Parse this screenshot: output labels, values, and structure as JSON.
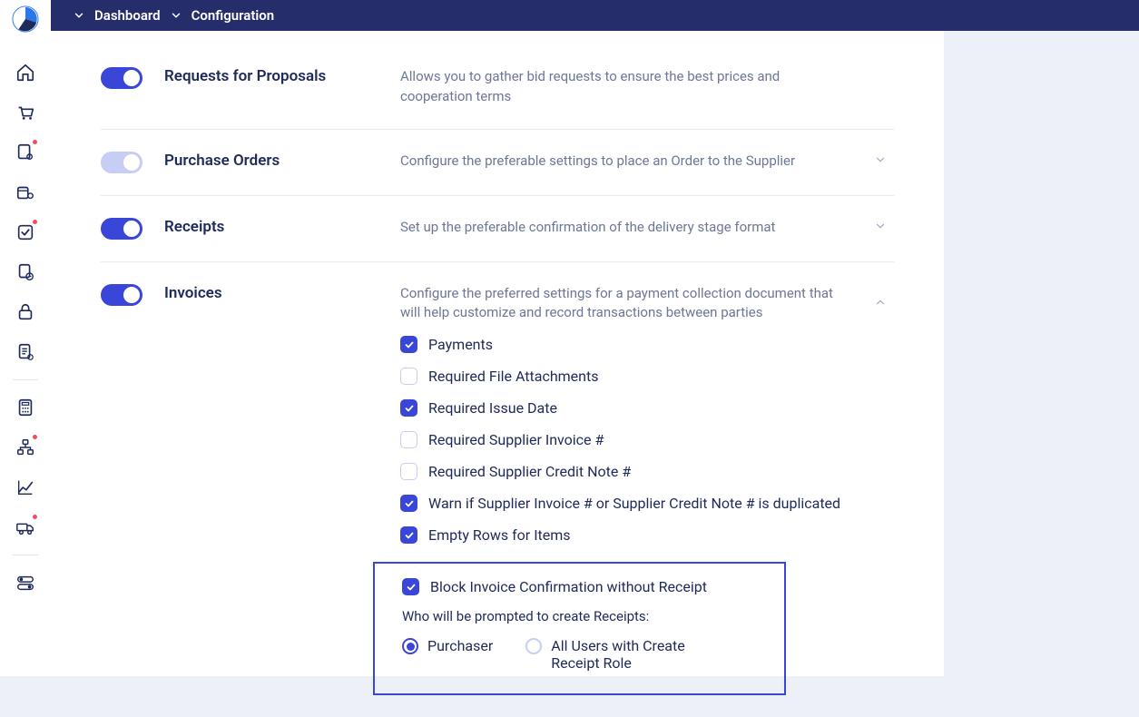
{
  "breadcrumb": {
    "items": [
      "Dashboard",
      "Configuration"
    ]
  },
  "sidebar": {
    "items": [
      {
        "name": "home-icon",
        "badge": false
      },
      {
        "name": "cart-icon",
        "badge": false
      },
      {
        "name": "doc-person-icon",
        "badge": true
      },
      {
        "name": "box-person-icon",
        "badge": false
      },
      {
        "name": "checkbox-icon",
        "badge": true
      },
      {
        "name": "doc-clock-icon",
        "badge": false
      },
      {
        "name": "lock-icon",
        "badge": false
      },
      {
        "name": "doc-list-icon",
        "badge": false
      }
    ],
    "bottomItems": [
      {
        "name": "calculator-icon",
        "badge": false
      },
      {
        "name": "org-chart-icon",
        "badge": true
      },
      {
        "name": "chart-line-icon",
        "badge": false
      },
      {
        "name": "truck-icon",
        "badge": true
      }
    ],
    "last": [
      {
        "name": "toggle-icon",
        "badge": false
      }
    ]
  },
  "sections": [
    {
      "key": "rfp",
      "toggle": true,
      "title": "Requests for Proposals",
      "desc": "Allows you to gather bid requests to ensure the best prices and cooperation terms",
      "expandable": false
    },
    {
      "key": "po",
      "toggle": false,
      "title": "Purchase Orders",
      "desc": "Configure the preferable settings to place an Order to the Supplier",
      "expandable": true,
      "expanded": false
    },
    {
      "key": "receipts",
      "toggle": true,
      "title": "Receipts",
      "desc": "Set up the preferable confirmation of the delivery stage format",
      "expandable": true,
      "expanded": false
    },
    {
      "key": "invoices",
      "toggle": true,
      "title": "Invoices",
      "desc": "Configure the preferred settings for a payment collection document that will help customize and record transactions between parties",
      "expandable": true,
      "expanded": true,
      "options": [
        {
          "label": "Payments",
          "checked": true
        },
        {
          "label": "Required File Attachments",
          "checked": false
        },
        {
          "label": "Required Issue Date",
          "checked": true
        },
        {
          "label": "Required Supplier Invoice #",
          "checked": false
        },
        {
          "label": "Required Supplier Credit Note #",
          "checked": false
        },
        {
          "label": "Warn if Supplier Invoice # or Supplier Credit Note # is duplicated",
          "checked": true
        },
        {
          "label": "Empty Rows for Items",
          "checked": true
        }
      ],
      "highlight": {
        "option": {
          "label": "Block Invoice Confirmation without Receipt",
          "checked": true
        },
        "promptLabel": "Who will be prompted to create Receipts:",
        "radios": [
          {
            "label": "Purchaser",
            "selected": true
          },
          {
            "label": "All Users with Create Receipt Role",
            "selected": false
          }
        ]
      }
    }
  ]
}
